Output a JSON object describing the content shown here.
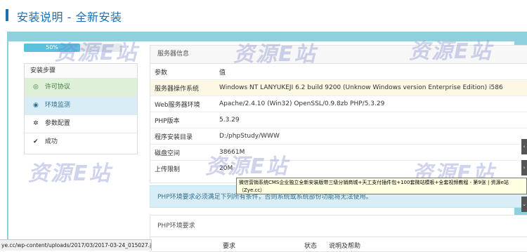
{
  "page": {
    "title": "安装说明 - 全新安装"
  },
  "progress": {
    "label": "50%",
    "percent": 50
  },
  "steps": {
    "heading": "安装步骤",
    "items": [
      {
        "label": "许可协议",
        "icon": "check-circle-icon",
        "state": "done"
      },
      {
        "label": "环境监测",
        "icon": "eye-icon",
        "state": "active"
      },
      {
        "label": "参数配置",
        "icon": "gear-icon",
        "state": "pending"
      },
      {
        "label": "成功",
        "icon": "checkmark-icon",
        "state": "pending"
      }
    ]
  },
  "server_info": {
    "title": "服务器信息",
    "header": {
      "key": "参数",
      "value": "值"
    },
    "rows": [
      {
        "key": "服务器操作系统",
        "value": "Windows NT LANYUKEJI 6.2 build 9200 (Unknow Windows version Enterprise Edition) i586"
      },
      {
        "key": "Web服务器环境",
        "value": "Apache/2.4.10 (Win32) OpenSSL/0.9.8zb PHP/5.3.29"
      },
      {
        "key": "PHP版本",
        "value": "5.3.29"
      },
      {
        "key": "程序安装目录",
        "value": "D:/phpStudy/WWW"
      },
      {
        "key": "磁盘空间",
        "value": "38661M"
      },
      {
        "key": "上传限制",
        "value": "20M"
      }
    ]
  },
  "alert": {
    "text": "PHP环境要求必须满足下列所有条件，否则系统或系统部份功能将无法使用。"
  },
  "env": {
    "title": "PHP环境要求",
    "columns": {
      "req": "要求",
      "status": "状态",
      "help": "说明及帮助"
    }
  },
  "tooltip": {
    "text": "微信营销系统CMS企业独立全新安装版带三级分销商城+天工支付插件包+100套微站模板+全套视频教程 - 第9张 | 资源e站（Zye.cc）"
  },
  "statusbar": {
    "url": "ye.cc/wp-content/uploads/2017/03/2017-03-24_015027.jpg"
  },
  "watermark": {
    "text": "资源E站",
    "sub": "ZYE.CC"
  },
  "colors": {
    "accent": "#1a6fb5",
    "frame": "#8ed1dc",
    "done": "#dff0d8",
    "active": "#d9edf7",
    "highlight": "#fcf8e3"
  }
}
